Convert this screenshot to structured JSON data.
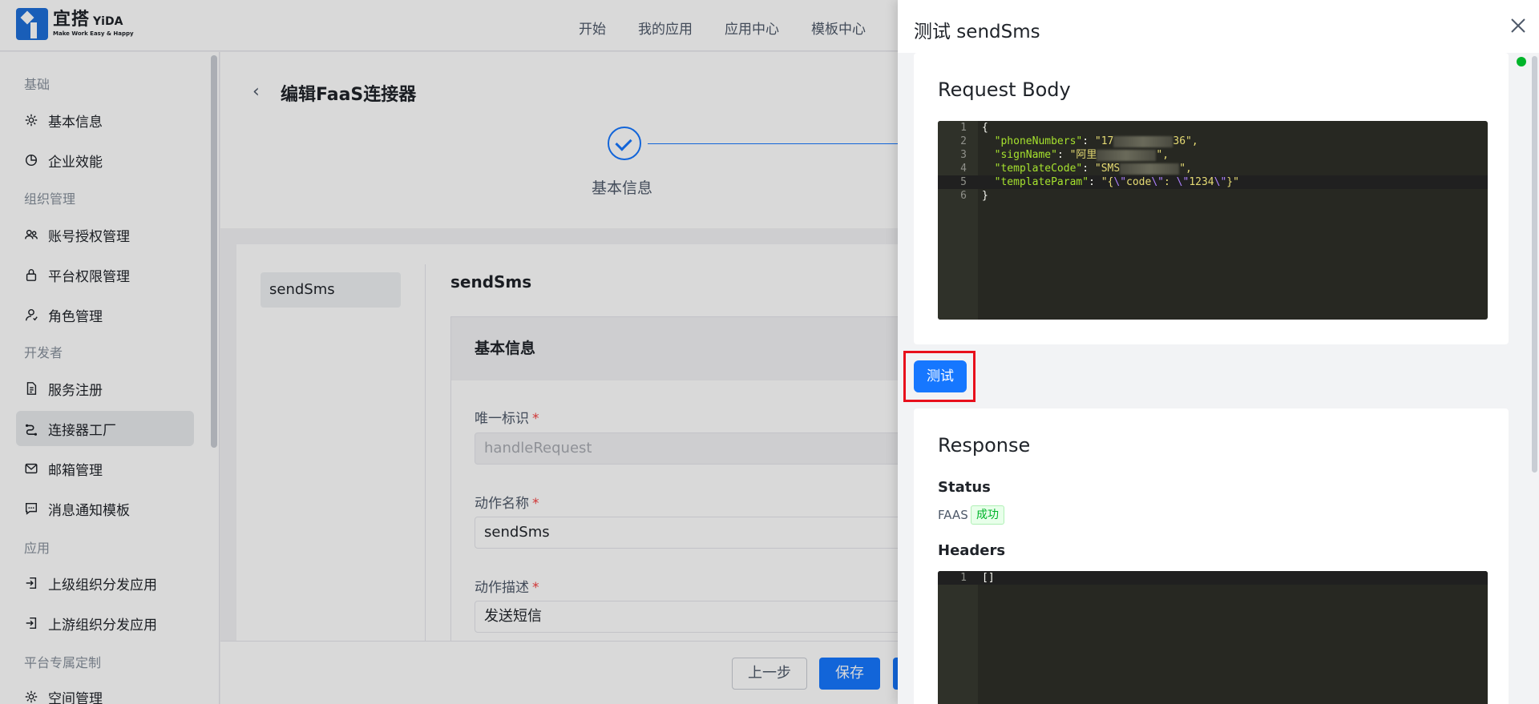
{
  "brand": {
    "name_cn": "宜搭",
    "name_en": "YiDA",
    "tagline": "Make Work Easy & Happy"
  },
  "nav": {
    "items": [
      "开始",
      "我的应用",
      "应用中心",
      "模板中心"
    ]
  },
  "sidebar": {
    "groups": [
      {
        "title": "基础",
        "items": [
          {
            "label": "基本信息",
            "icon": "gear-icon"
          },
          {
            "label": "企业效能",
            "icon": "pie-chart-icon"
          }
        ]
      },
      {
        "title": "组织管理",
        "items": [
          {
            "label": "账号授权管理",
            "icon": "users-icon"
          },
          {
            "label": "平台权限管理",
            "icon": "lock-icon"
          },
          {
            "label": "角色管理",
            "icon": "user-icon"
          }
        ]
      },
      {
        "title": "开发者",
        "items": [
          {
            "label": "服务注册",
            "icon": "document-icon"
          },
          {
            "label": "连接器工厂",
            "icon": "connector-icon",
            "active": true
          },
          {
            "label": "邮箱管理",
            "icon": "mail-icon"
          },
          {
            "label": "消息通知模板",
            "icon": "message-icon"
          }
        ]
      },
      {
        "title": "应用",
        "items": [
          {
            "label": "上级组织分发应用",
            "icon": "login-icon"
          },
          {
            "label": "上游组织分发应用",
            "icon": "login-icon"
          }
        ]
      },
      {
        "title": "平台专属定制",
        "items": [
          {
            "label": "空间管理",
            "icon": "gear-icon"
          }
        ]
      }
    ]
  },
  "page": {
    "title": "编辑FaaS连接器",
    "step_label": "基本信息",
    "action_item": "sendSms",
    "action_title": "sendSms",
    "section_title": "基本信息",
    "fields": {
      "unique_id": {
        "label": "唯一标识",
        "value": "handleRequest"
      },
      "action_name": {
        "label": "动作名称",
        "value": "sendSms"
      },
      "action_desc": {
        "label": "动作描述",
        "value": "发送短信"
      }
    },
    "buttons": {
      "prev": "上一步",
      "save": "保存"
    }
  },
  "drawer": {
    "title": "测试 sendSms",
    "request_body_title": "Request Body",
    "request_lines": [
      {
        "n": "1",
        "text": "{"
      },
      {
        "n": "2",
        "key": "\"phoneNumbers\"",
        "val_pre": "\"17",
        "val_post": "36\","
      },
      {
        "n": "3",
        "key": "\"signName\"",
        "val_pre": "\"阿里",
        "val_post": "\","
      },
      {
        "n": "4",
        "key": "\"templateCode\"",
        "val_pre": "\"SMS",
        "val_post": "\","
      },
      {
        "n": "5",
        "key": "\"templateParam\"",
        "val_pre": "\"{",
        "esc1": "\\\"",
        "mid1": "code",
        "esc2": "\\\"",
        "mid2": ": ",
        "esc3": "\\\"",
        "mid3": "1234",
        "esc4": "\\\"",
        "val_post": "}\""
      },
      {
        "n": "6",
        "text": "}"
      }
    ],
    "test_button": "测试",
    "response_title": "Response",
    "status_label": "Status",
    "status_type": "FAAS",
    "status_badge": "成功",
    "headers_label": "Headers",
    "headers_lines": [
      {
        "n": "1",
        "text": "[]"
      }
    ]
  },
  "colors": {
    "accent": "#1677ff",
    "success": "#00b42a",
    "highlight_box": "#e8101c",
    "editor_bg": "#272822"
  }
}
